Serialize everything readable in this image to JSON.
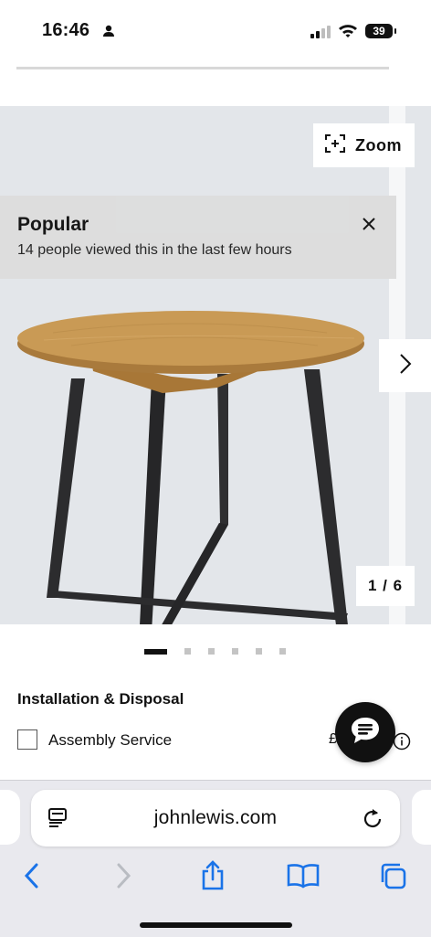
{
  "status_bar": {
    "time": "16:46",
    "battery": "39"
  },
  "gallery": {
    "zoom_label": "Zoom",
    "counter": "1 / 6",
    "popular": {
      "title": "Popular",
      "subtitle": "14 people viewed this in the last few hours"
    },
    "dots_total": 6,
    "dots_active_index": 0
  },
  "installation": {
    "title": "Installation & Disposal",
    "assembly_label": "Assembly Service",
    "assembly_checked": false,
    "price_symbol": "£"
  },
  "browser": {
    "url": "johnlewis.com"
  },
  "icons": {
    "person": "person-icon",
    "signal": "cellular-signal-icon",
    "wifi": "wifi-icon",
    "zoom": "zoom-icon",
    "close": "close-icon",
    "next": "chevron-right-icon",
    "info": "info-icon",
    "chat": "chat-bubble-icon",
    "reader": "reader-mode-icon",
    "reload": "reload-icon",
    "back": "back-arrow-icon",
    "forward": "forward-arrow-icon",
    "share": "share-icon",
    "bookmarks": "bookmarks-icon",
    "tabs": "tabs-icon"
  },
  "colors": {
    "accent_blue": "#1a73e8",
    "gallery_bg": "#e3e6ea",
    "wood": "#c99a55",
    "metal": "#2c2c2e"
  }
}
